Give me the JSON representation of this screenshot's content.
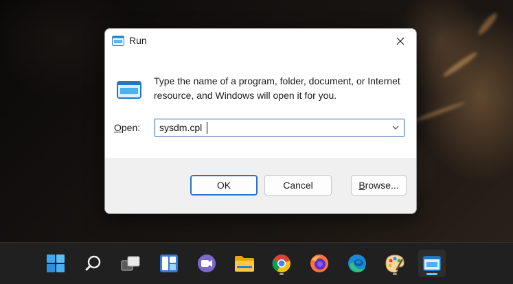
{
  "dialog": {
    "title": "Run",
    "description": "Type the name of a program, folder, document, or Internet resource, and Windows will open it for you.",
    "open_label_prefix": "",
    "open_label_access": "O",
    "open_label_rest": "pen:",
    "open_value": "sysdm.cpl",
    "buttons": {
      "ok": "OK",
      "cancel": "Cancel",
      "browse_access": "B",
      "browse_rest": "rowse..."
    }
  },
  "taskbar": {
    "items": [
      {
        "icon": "windows-start-icon"
      },
      {
        "icon": "search-icon"
      },
      {
        "icon": "task-view-icon"
      },
      {
        "icon": "widgets-icon"
      },
      {
        "icon": "teams-chat-icon"
      },
      {
        "icon": "file-explorer-icon"
      },
      {
        "icon": "chrome-icon",
        "running": true
      },
      {
        "icon": "firefox-icon"
      },
      {
        "icon": "edge-icon"
      },
      {
        "icon": "paint-icon",
        "running": true
      },
      {
        "icon": "run-icon",
        "active": true
      }
    ]
  },
  "colors": {
    "accent": "#2f6fc4",
    "taskbar_bg": "#202020",
    "active_indicator": "#60cdff"
  }
}
